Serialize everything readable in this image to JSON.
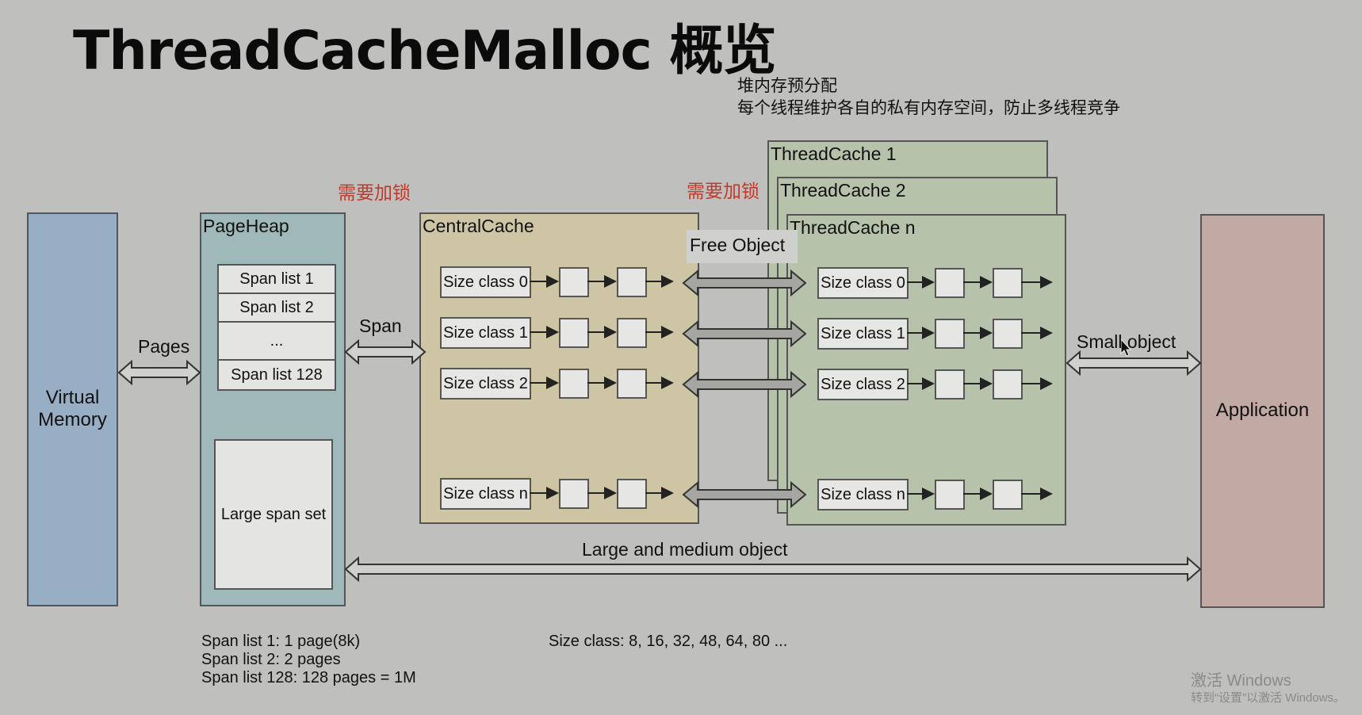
{
  "title": "ThreadCacheMalloc 概览",
  "notes": [
    "堆内存预分配",
    "每个线程维护各自的私有内存空间，防止多线程竞争"
  ],
  "locks": [
    "需要加锁",
    "需要加锁"
  ],
  "virtual_memory": "Virtual\nMemory",
  "page_heap": {
    "title": "PageHeap",
    "span_lists": [
      "Span list 1",
      "Span list 2",
      "...",
      "Span list 128"
    ],
    "large_span_set": "Large span set"
  },
  "central_cache": {
    "title": "CentralCache",
    "size_classes": [
      "Size class 0",
      "Size class 1",
      "Size class 2",
      "Size class n"
    ]
  },
  "thread_caches": [
    "ThreadCache 1",
    "ThreadCache 2",
    "ThreadCache n"
  ],
  "thread_size_classes": [
    "Size class 0",
    "Size class 1",
    "Size class 2",
    "Size class n"
  ],
  "free_object": "Free Object",
  "application": "Application",
  "arrows": {
    "pages": "Pages",
    "span": "Span",
    "small_object": "Small object",
    "large_medium": "Large and medium object"
  },
  "footnotes": {
    "span_lists": [
      "Span list 1: 1 page(8k)",
      "Span list 2: 2 pages",
      "Span list 128: 128 pages = 1M"
    ],
    "size_class": "Size class: 8, 16, 32, 48, 64, 80 ..."
  },
  "watermark": [
    "激活 Windows",
    "转到“设置”以激活 Windows。"
  ]
}
